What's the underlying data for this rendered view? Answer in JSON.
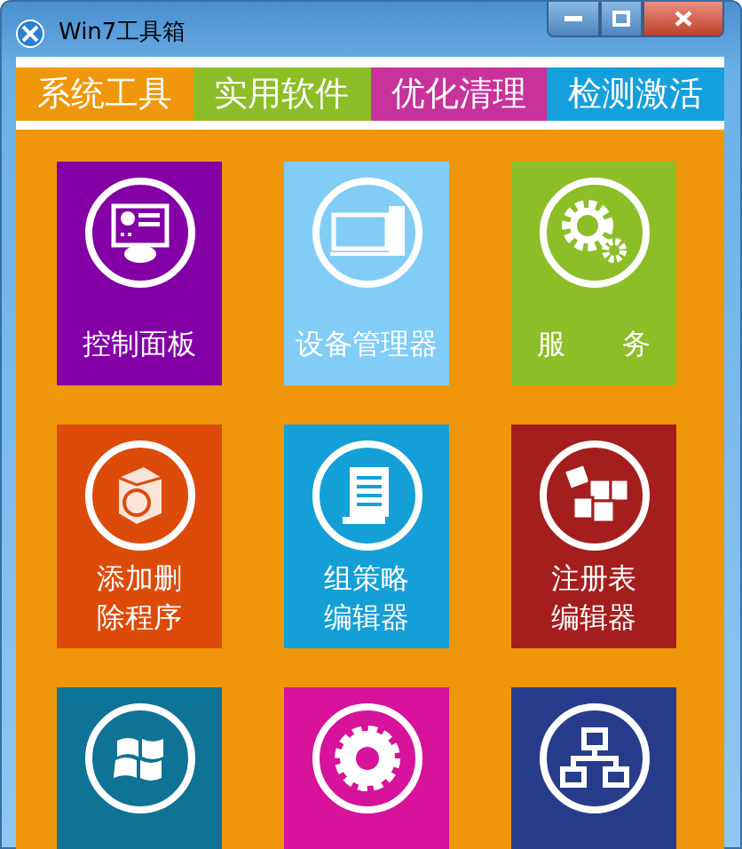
{
  "window": {
    "title": "Win7工具箱"
  },
  "tabs": [
    {
      "label": "系统工具",
      "color": "#f0960a"
    },
    {
      "label": "实用软件",
      "color": "#8cbe28"
    },
    {
      "label": "优化清理",
      "color": "#c8329b"
    },
    {
      "label": "检测激活",
      "color": "#14a0dc"
    }
  ],
  "tiles": [
    {
      "kind": "panel",
      "color": "#8200a5",
      "lines": [
        "控制面板"
      ]
    },
    {
      "kind": "computer",
      "color": "#82cdf5",
      "lines": [
        "设备管理器"
      ]
    },
    {
      "kind": "gears",
      "color": "#8cbe28",
      "lines": [
        "服　　务"
      ]
    },
    {
      "kind": "box",
      "color": "#dc4b0a",
      "lines": [
        "添加删",
        "除程序"
      ]
    },
    {
      "kind": "scroll",
      "color": "#14a0d7",
      "lines": [
        "组策略",
        "编辑器"
      ]
    },
    {
      "kind": "cubes",
      "color": "#a51e1e",
      "lines": [
        "注册表",
        "编辑器"
      ]
    },
    {
      "kind": "windows",
      "color": "#0f7396"
    },
    {
      "kind": "gear",
      "color": "#d7129b"
    },
    {
      "kind": "network",
      "color": "#283c8c"
    }
  ]
}
